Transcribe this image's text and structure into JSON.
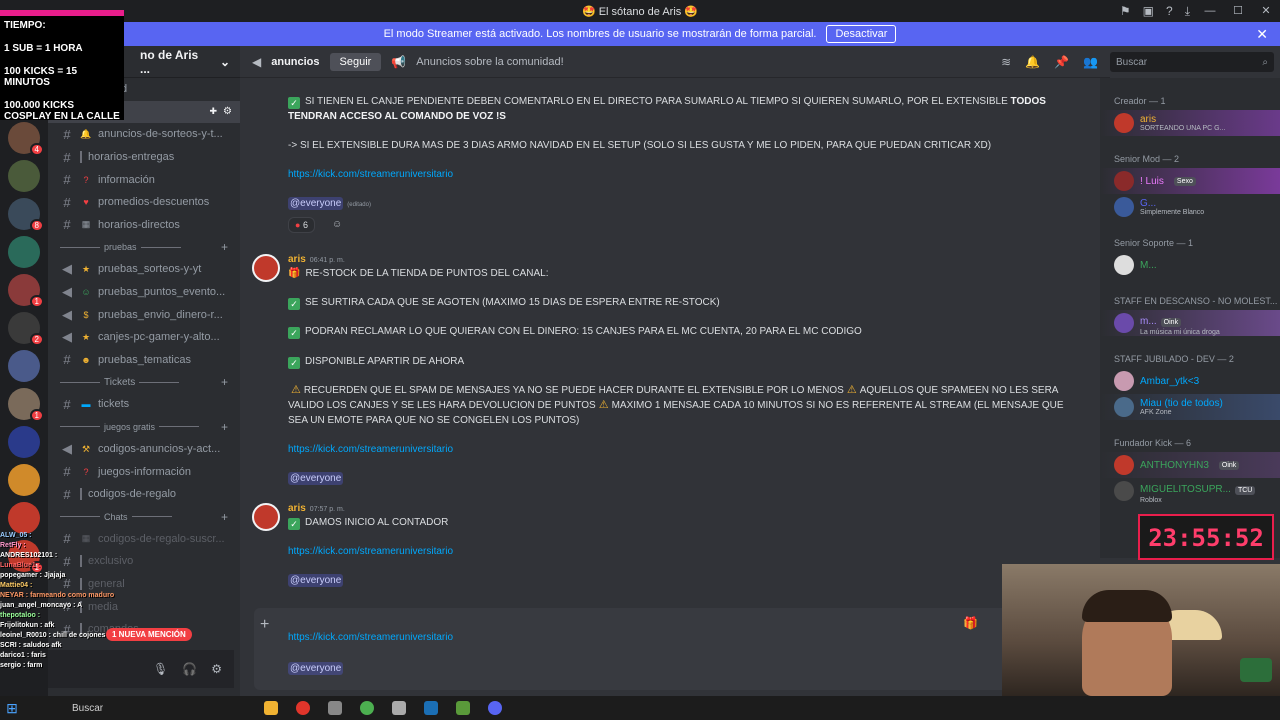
{
  "window": {
    "title": "🤩 El sótano de Aris 🤩"
  },
  "banner": {
    "text": "El modo Streamer está activado. Los nombres de usuario se mostrarán de forma parcial.",
    "button": "Desactivar"
  },
  "overlay": {
    "lines": [
      "TIEMPO:",
      "1 SUB = 1 HORA",
      "100 KICKS = 15 MINUTOS",
      "100.000 KICKS COSPLAY EN LA CALLE"
    ]
  },
  "server": {
    "name": "no de Aris ..."
  },
  "sidebar": {
    "items": [
      {
        "label": "s_discord",
        "type": "channel"
      },
      {
        "label": "cios",
        "type": "channel"
      },
      {
        "label": "anuncios-de-sorteos-y-t...",
        "type": "channel"
      },
      {
        "label": "horarios-entregas",
        "type": "channel"
      },
      {
        "label": "información",
        "type": "channel"
      },
      {
        "label": "promedios-descuentos",
        "type": "channel"
      },
      {
        "label": "horarios-directos",
        "type": "channel"
      },
      {
        "label": "pruebas",
        "type": "category"
      },
      {
        "label": "pruebas_sorteos-y-yt",
        "type": "channel"
      },
      {
        "label": "pruebas_puntos_evento...",
        "type": "channel"
      },
      {
        "label": "pruebas_envio_dinero-r...",
        "type": "channel"
      },
      {
        "label": "canjes-pc-gamer-y-alto...",
        "type": "channel"
      },
      {
        "label": "pruebas_tematicas",
        "type": "channel"
      },
      {
        "label": "Tickets",
        "type": "category"
      },
      {
        "label": "tickets",
        "type": "channel"
      },
      {
        "label": "juegos gratis",
        "type": "category"
      },
      {
        "label": "codigos-anuncios-y-act...",
        "type": "channel"
      },
      {
        "label": "juegos-información",
        "type": "channel"
      },
      {
        "label": "codigos-de-regalo",
        "type": "channel"
      },
      {
        "label": "Chats",
        "type": "category"
      },
      {
        "label": "codigos-de-regalo-suscr...",
        "type": "channel"
      },
      {
        "label": "exclusivo",
        "type": "channel"
      },
      {
        "label": "general",
        "type": "channel"
      },
      {
        "label": "media",
        "type": "channel"
      },
      {
        "label": "comandos",
        "type": "channel"
      }
    ],
    "mention_pill": "1 NUEVA MENCIÓN"
  },
  "chat_overlay": [
    "ALW_05 :",
    "RetFly :",
    "ANDRES102101 :",
    "LunaBlue1 :",
    "popegamer : Jjajaja",
    "Mattie04 :",
    "NEYAR : farmeando como maduro",
    "juan_angel_moncayo : A",
    "thepotaloo :",
    "Frijolitokun : afk",
    "leoinel_R0010 : chill de cojones",
    "SCRI : saludos afk",
    "darico1 : faris",
    "sergio : farm"
  ],
  "channel": {
    "name": "anuncios",
    "follow": "Seguir",
    "topic": "Anuncios sobre la comunidad!"
  },
  "search": {
    "placeholder": "Buscar"
  },
  "messages": {
    "m0": {
      "l1": "SI TIENEN EL CANJE PENDIENTE DEBEN COMENTARLO EN EL DIRECTO PARA SUMARLO AL TIEMPO SI QUIEREN SUMARLO, POR EL EXTENSIBLE ",
      "l1b": "TODOS TENDRAN ACCESO AL COMANDO DE VOZ !S",
      "l2": "-> SI EL EXTENSIBLE DURA MAS DE 3 DIAS ARMO NAVIDAD EN EL SETUP (SOLO SI LES GUSTA Y ME LO PIDEN, PARA QUE PUEDAN CRITICAR XD)",
      "link": "https://kick.com/streameruniversitario",
      "mention": "@everyone",
      "edited": "(editado)",
      "reaction": "6"
    },
    "m1": {
      "author": "aris",
      "time": "06:41 p. m.",
      "l1": "RE-STOCK DE LA TIENDA DE PUNTOS DEL CANAL:",
      "l2": "SE SURTIRA CADA QUE SE AGOTEN (MAXIMO 15 DIAS DE ESPERA ENTRE RE-STOCK)",
      "l3": "PODRAN RECLAMAR LO QUE QUIERAN CON EL DINERO: 15 CANJES PARA EL MC CUENTA, 20 PARA EL MC CODIGO",
      "l4": "DISPONIBLE APARTIR DE AHORA",
      "l5a": "RECUERDEN QUE EL SPAM DE MENSAJES YA NO SE PUEDE HACER DURANTE EL EXTENSIBLE POR LO MENOS",
      "l5b": "AQUELLOS QUE SPAMEEN NO LES SERA VALIDO LOS CANJES Y SE LES HARA DEVOLUCION DE PUNTOS",
      "l5c": "MAXIMO 1 MENSAJE CADA 10 MINUTOS SI NO ES REFERENTE AL STREAM (EL MENSAJE QUE SEA UN EMOTE PARA QUE NO SE CONGELEN LOS PUNTOS)",
      "link": "https://kick.com/streameruniversitario",
      "mention": "@everyone"
    },
    "m2": {
      "author": "aris",
      "time": "07:57 p. m.",
      "l1": "DAMOS INICIO AL CONTADOR",
      "link": "https://kick.com/streameruniversitario",
      "mention": "@everyone"
    }
  },
  "composer": {
    "link": "https://kick.com/streameruniversitario",
    "mention": "@everyone"
  },
  "members": {
    "g1": "Creador — 1",
    "g1m1": {
      "name": "aris",
      "sub": "SORTEANDO UNA PC G..."
    },
    "g2": "Senior Mod — 2",
    "g2m1": {
      "name": "! Luis",
      "tag": "Sexo"
    },
    "g2m2": {
      "name": "G...",
      "sub": "Simplemente Blanco"
    },
    "g3": "Senior Soporte — 1",
    "g3m1": {
      "name": "M..."
    },
    "g4": "STAFF EN DESCANSO - NO MOLEST...",
    "g4m1": {
      "name": "m...",
      "tag": "Oink",
      "sub": "La música mi única droga"
    },
    "g5": "STAFF JUBILADO - DEV — 2",
    "g5m1": {
      "name": "Ambar_ytk<3"
    },
    "g5m2": {
      "name": "Miau (tio de todos)",
      "sub": "AFK Zone"
    },
    "g6": "Fundador Kick — 6",
    "g6m1": {
      "name": "ANTHONYHN3",
      "tag": "Oink"
    },
    "g6m2": {
      "name": "MIGUELITOSUPR...",
      "tag": "TCU",
      "sub": "Roblox"
    }
  },
  "timer": "23:55:52",
  "taskbar": {
    "search": "Buscar"
  },
  "colors": {
    "accent": "#5865f2",
    "link": "#00a8fc",
    "author": "#f0b232",
    "timer": "#ff3d6b"
  }
}
